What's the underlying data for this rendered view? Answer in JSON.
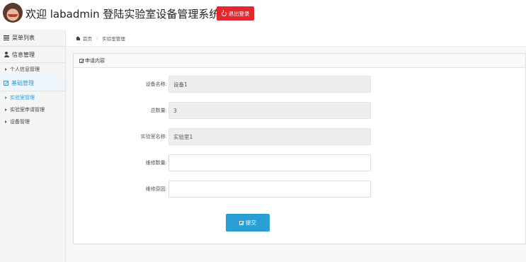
{
  "header": {
    "title": "欢迎 labadmin 登陆实验室设备管理系统",
    "logout_label": "退出登录",
    "colors": {
      "logout": "#e0292e"
    }
  },
  "sidebar": {
    "heading": "菜单列表",
    "sections": [
      {
        "label": "信息管理",
        "icon": "user-icon",
        "items": [
          {
            "label": "个人信息管理"
          }
        ]
      },
      {
        "label": "基础管理",
        "icon": "edit-icon",
        "active": true,
        "items": [
          {
            "label": "实验室管理",
            "active": true
          },
          {
            "label": "实验室申请管理"
          },
          {
            "label": "设备管理"
          }
        ]
      }
    ]
  },
  "breadcrumb": {
    "home": "首页",
    "current": "实验室管理"
  },
  "panel": {
    "title": "申请内容",
    "fields": [
      {
        "label": "设备名称:",
        "value": "设备1",
        "readonly": true
      },
      {
        "label": "总数量:",
        "value": "3",
        "readonly": true
      },
      {
        "label": "实验室名称:",
        "value": "实验室1",
        "readonly": true
      },
      {
        "label": "维修数量:",
        "value": "",
        "readonly": false
      },
      {
        "label": "维修原因:",
        "value": "",
        "readonly": false
      }
    ],
    "submit_label": "提交",
    "colors": {
      "accent": "#2a9fd6"
    }
  }
}
